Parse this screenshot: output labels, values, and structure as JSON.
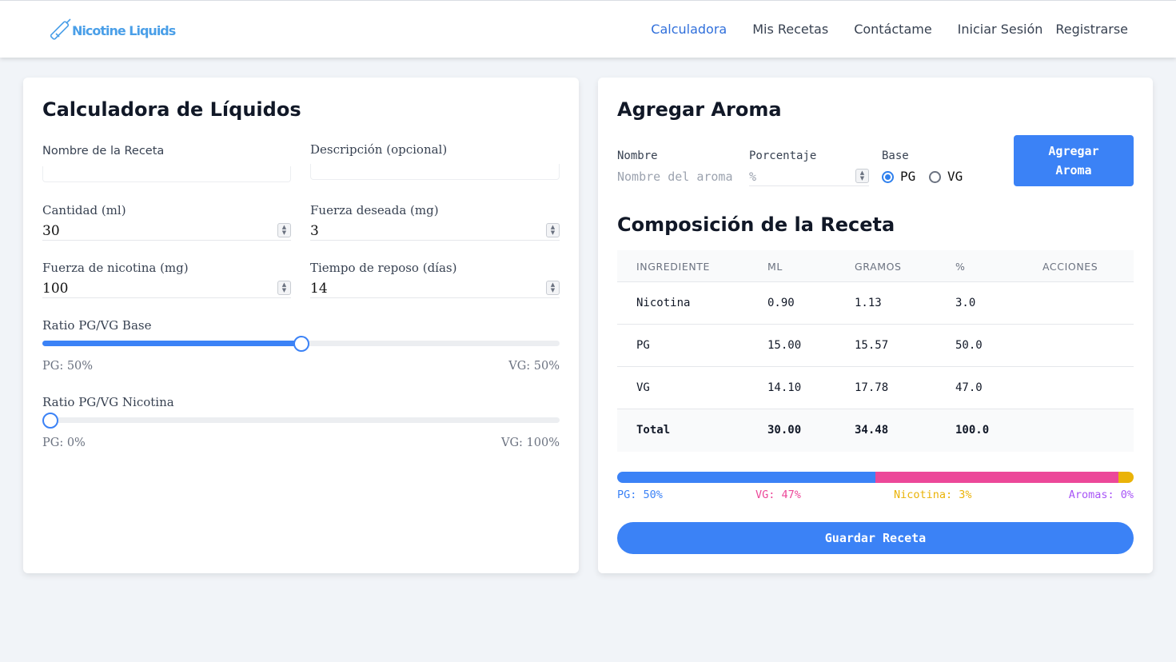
{
  "brand": {
    "name": "Nicotine Liquids",
    "color": "#4a9fe8"
  },
  "nav": {
    "items": [
      "Calculadora",
      "Mis Recetas",
      "Contáctame",
      "Iniciar Sesión",
      "Registrarse"
    ],
    "active": "Calculadora"
  },
  "calculator": {
    "title": "Calculadora de Líquidos",
    "recipe_name_label": "Nombre de la Receta",
    "recipe_name_value": "",
    "description_label": "Descripción (opcional)",
    "description_value": "",
    "amount_label": "Cantidad (ml)",
    "amount_value": "30",
    "desired_strength_label": "Fuerza deseada (mg)",
    "desired_strength_value": "3",
    "nicotine_strength_label": "Fuerza de nicotina (mg)",
    "nicotine_strength_value": "100",
    "steep_time_label": "Tiempo de reposo (días)",
    "steep_time_value": "14",
    "base_ratio": {
      "label": "Ratio PG/VG Base",
      "pg_percent": 50,
      "pg_text": "PG: 50%",
      "vg_text": "VG: 50%"
    },
    "nicotine_ratio": {
      "label": "Ratio PG/VG Nicotina",
      "pg_percent": 0,
      "pg_text": "PG: 0%",
      "vg_text": "VG: 100%"
    }
  },
  "aroma": {
    "title": "Agregar Aroma",
    "name_label": "Nombre",
    "name_placeholder": "Nombre del aroma",
    "percent_label": "Porcentaje",
    "percent_placeholder": "%",
    "base_label": "Base",
    "base_options": [
      "PG",
      "VG"
    ],
    "base_selected": "PG",
    "add_button_line1": "Agregar",
    "add_button_line2": "Aroma"
  },
  "composition": {
    "title": "Composición de la Receta",
    "columns": [
      "INGREDIENTE",
      "ML",
      "GRAMOS",
      "%",
      "ACCIONES"
    ],
    "rows": [
      {
        "ingredient": "Nicotina",
        "ml": "0.90",
        "grams": "1.13",
        "percent": "3.0"
      },
      {
        "ingredient": "PG",
        "ml": "15.00",
        "grams": "15.57",
        "percent": "50.0"
      },
      {
        "ingredient": "VG",
        "ml": "14.10",
        "grams": "17.78",
        "percent": "47.0"
      }
    ],
    "total": {
      "ingredient": "Total",
      "ml": "30.00",
      "grams": "34.48",
      "percent": "100.0"
    },
    "bar": [
      {
        "name": "PG",
        "percent": 50,
        "color": "#3b82f6",
        "text": "PG: 50%"
      },
      {
        "name": "VG",
        "percent": 47,
        "color": "#ec4899",
        "text": "VG: 47%"
      },
      {
        "name": "Nicotina",
        "percent": 3,
        "color": "#eab308",
        "text": "Nicotina: 3%"
      },
      {
        "name": "Aromas",
        "percent": 0,
        "color": "#a855f7",
        "text": "Aromas: 0%"
      }
    ],
    "save_button": "Guardar Receta"
  }
}
